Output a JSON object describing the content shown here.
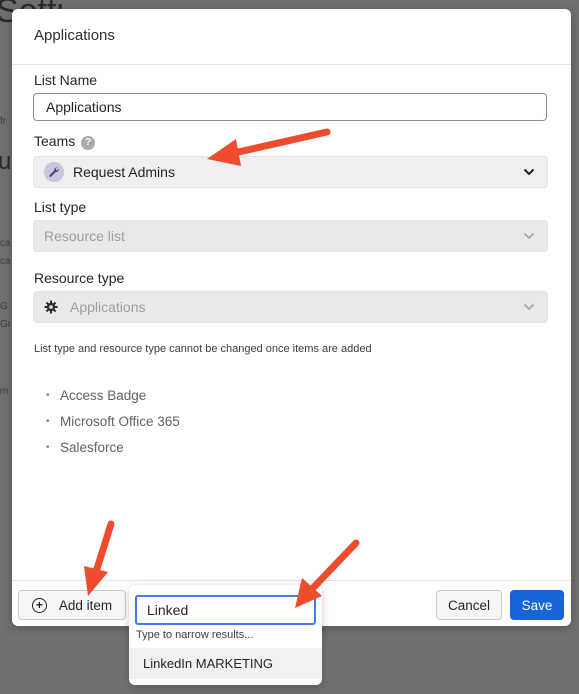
{
  "background": {
    "fragments": [
      "Setti",
      "u",
      "fr",
      "ca",
      "ca",
      "G",
      "Gr",
      "m"
    ]
  },
  "modal": {
    "title": "Applications",
    "list_name": {
      "label": "List Name",
      "value": "Applications"
    },
    "teams": {
      "label": "Teams",
      "help_icon": "question-icon",
      "selected": "Request Admins",
      "avatar_icon": "wrench-icon"
    },
    "list_type": {
      "label": "List type",
      "value": "Resource list"
    },
    "resource_type": {
      "label": "Resource type",
      "value": "Applications",
      "icon": "gear-icon"
    },
    "note": "List type and resource type cannot be changed once items are added",
    "items": [
      "Access Badge",
      "Microsoft Office 365",
      "Salesforce"
    ],
    "footer": {
      "add_item": "Add item",
      "cancel": "Cancel",
      "save": "Save"
    }
  },
  "dropdown": {
    "query": "Linked",
    "hint": "Type to narrow results...",
    "options": [
      "LinkedIn MARKETING"
    ]
  },
  "colors": {
    "primary": "#1665d8",
    "arrow": "#ee4c2c",
    "focus": "#3d7ee8"
  }
}
